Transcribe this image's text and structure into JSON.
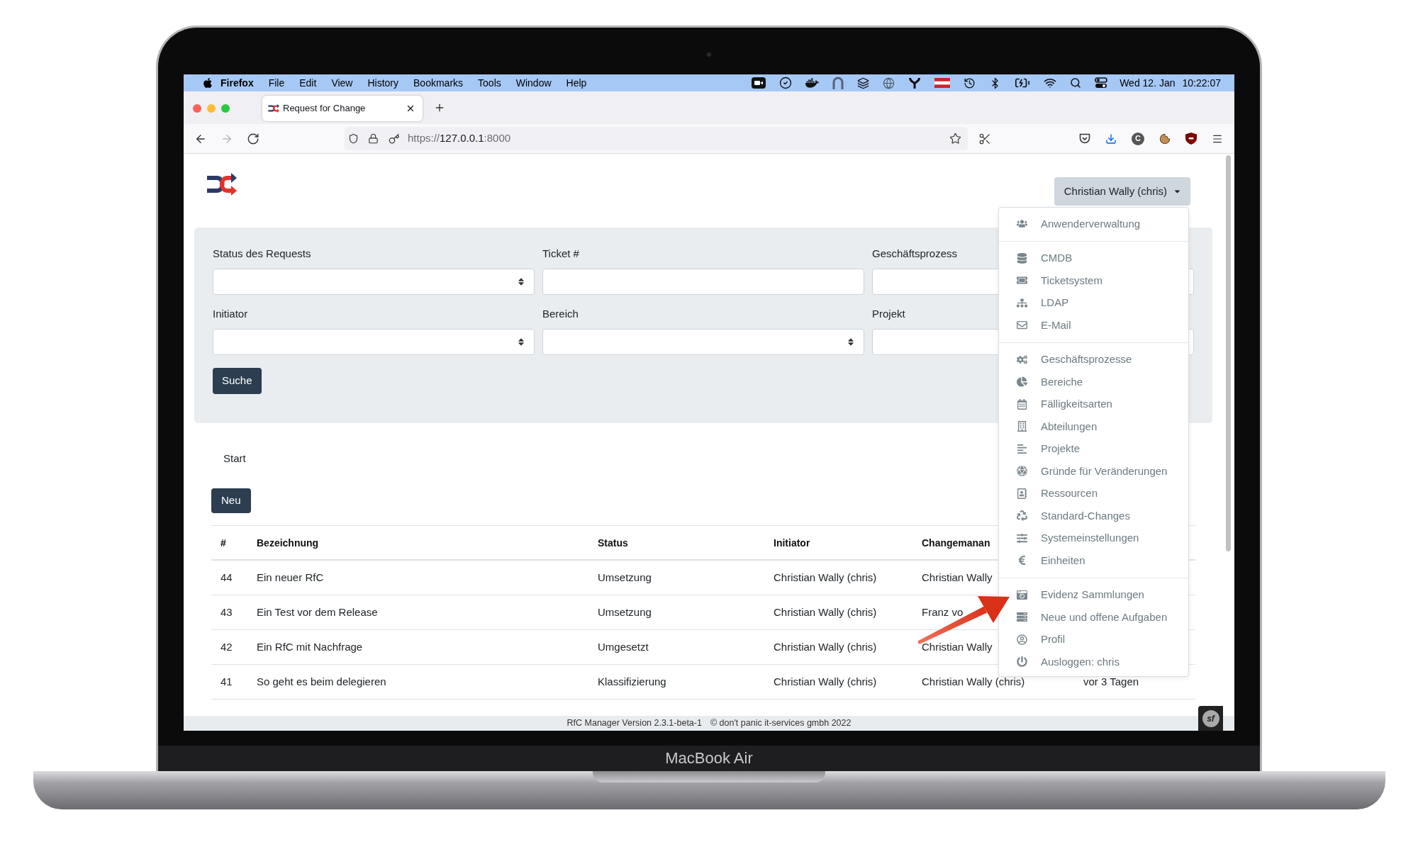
{
  "device": {
    "label": "MacBook Air"
  },
  "menu_bar": {
    "app": "Firefox",
    "menus": [
      "File",
      "Edit",
      "View",
      "History",
      "Bookmarks",
      "Tools",
      "Window",
      "Help"
    ],
    "date": "Wed 12. Jan",
    "time": "10:22:07"
  },
  "browser": {
    "tabs": [
      {
        "title": "Request for Change",
        "selected": true
      }
    ],
    "url": {
      "scheme": "https://",
      "host": "127.0.0.1",
      "port": ":8000"
    },
    "extension_badge": "C"
  },
  "page": {
    "user_menu": {
      "label": "Christian Wally (chris)",
      "expanded": true,
      "groups": [
        [
          "Anwenderverwaltung"
        ],
        [
          "CMDB",
          "Ticketsystem",
          "LDAP",
          "E-Mail"
        ],
        [
          "Geschäftsprozesse",
          "Bereiche",
          "Fälligkeitsarten",
          "Abteilungen",
          "Projekte",
          "Gründe für Veränderungen",
          "Ressourcen",
          "Standard-Changes",
          "Systemeinstellungen",
          "Einheiten"
        ],
        [
          "Evidenz Sammlungen",
          "Neue und offene Aufgaben",
          "Profil",
          "Ausloggen: chris"
        ]
      ]
    },
    "filters": {
      "fields": [
        {
          "label": "Status des Requests",
          "kind": "select"
        },
        {
          "label": "Ticket #",
          "kind": "text"
        },
        {
          "label": "Geschäftsprozess",
          "kind": "text"
        },
        {
          "label": "Initiator",
          "kind": "select"
        },
        {
          "label": "Bereich",
          "kind": "select"
        },
        {
          "label": "Projekt",
          "kind": "text"
        }
      ],
      "submit": "Suche"
    },
    "breadcrumb": [
      "Start"
    ],
    "new_button": "Neu",
    "table": {
      "columns": [
        "#",
        "Bezeichnung",
        "Status",
        "Initiator",
        "Changemanan"
      ],
      "rows": [
        {
          "cells": [
            "44",
            "Ein neuer RfC",
            "Umsetzung",
            "Christian Wally (chris)",
            "Christian Wally"
          ]
        },
        {
          "cells": [
            "43",
            "Ein Test vor dem Release",
            "Umsetzung",
            "Christian Wally (chris)",
            "Franz vo"
          ]
        },
        {
          "cells": [
            "42",
            "Ein RfC mit Nachfrage",
            "Umgesetzt",
            "Christian Wally (chris)",
            "Christian Wally"
          ]
        },
        {
          "cells": [
            "41",
            "So geht es beim delegieren",
            "Klassifizierung",
            "Christian Wally (chris)",
            "Christian Wally (chris)",
            "vor 3 Tagen"
          ]
        }
      ]
    },
    "debug_toolbar": "sf"
  },
  "footer": {
    "version": "RfC Manager Version 2.3.1-beta-1",
    "copyright": "© don't panic it-services gmbh 2022"
  }
}
